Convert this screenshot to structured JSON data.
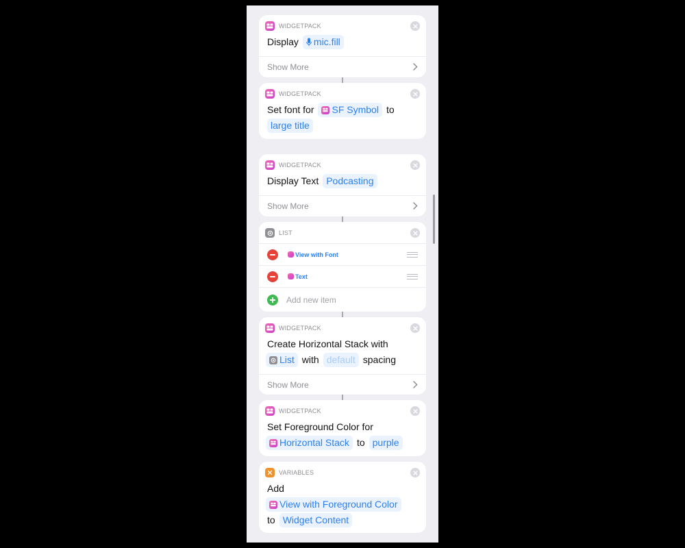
{
  "colors": {
    "accent": "#2a7ff5",
    "background": "#eeeef3",
    "delete": "#e5433a",
    "add": "#3fb950"
  },
  "cards": {
    "display": {
      "app": "WIDGETPACK",
      "label": "Display",
      "token": "mic.fill",
      "token_icon": "mic-fill-icon",
      "show_more": "Show More"
    },
    "set_font": {
      "app": "WIDGETPACK",
      "label": "Set font for",
      "token": "SF Symbol",
      "to": "to",
      "value": "large title"
    },
    "display_text": {
      "app": "WIDGETPACK",
      "label": "Display Text",
      "token": "Podcasting",
      "show_more": "Show More"
    },
    "list": {
      "app": "LIST",
      "items": [
        "View with Font",
        "Text"
      ],
      "add_label": "Add new item"
    },
    "hstack": {
      "app": "WIDGETPACK",
      "label": "Create Horizontal Stack with",
      "token": "List",
      "with": "with",
      "spacing_token": "default",
      "spacing": "spacing",
      "show_more": "Show More"
    },
    "fg_color": {
      "app": "WIDGETPACK",
      "label": "Set Foreground Color for",
      "token": "Horizontal Stack",
      "to": "to",
      "value": "purple"
    },
    "variables": {
      "app": "VARIABLES",
      "label": "Add",
      "token": "View with Foreground Color",
      "to": "to",
      "target": "Widget Content"
    }
  }
}
